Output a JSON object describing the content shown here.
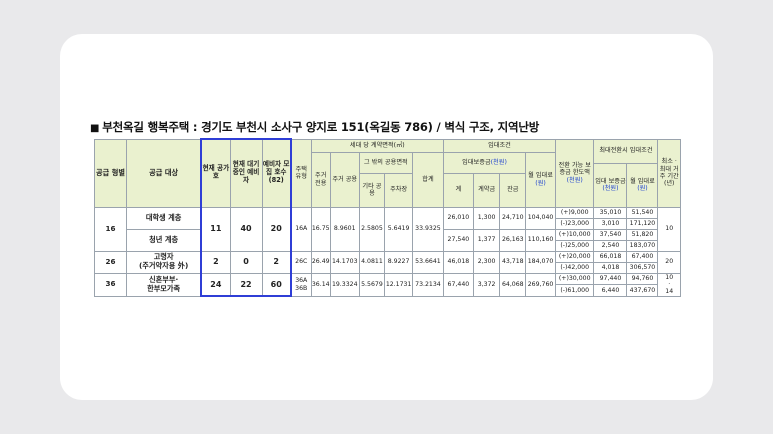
{
  "title": "부천옥길 행복주택 : 경기도 부천시 소사구 양지로 151(옥길동 786) / 벽식 구조, 지역난방",
  "title_marker": "■",
  "headers": {
    "supply_type": "공급 형별",
    "supply_target": "공급 대상",
    "current_vacancy": "현재 공가 호",
    "current_waiting": "현재 대기 중인 예비자",
    "reserve_recruit": "예비자 모집 호수",
    "reserve_recruit_count": "(82)",
    "house_type": "주택 유형",
    "area_group": "세대 당 계약면적(㎡)",
    "exclusive": "주거 전용",
    "shared": "주거 공용",
    "other_shared_group": "그 밖의 공용면적",
    "other_shared": "기타 공용",
    "parking": "주차장",
    "total": "합계",
    "lease_terms": "임대조건",
    "deposit_group": "임대보증금",
    "deposit_unit": "(천원)",
    "deposit_total": "계",
    "contract_fee": "계약금",
    "balance": "잔금",
    "monthly_rent": "월 임대료",
    "monthly_unit": "(원)",
    "conversion": "전환 가능 보증금 한도액",
    "conversion_unit": "(천원)",
    "max_conversion": "최대전환시 임대조건",
    "mc_deposit": "임대 보증금",
    "mc_deposit_unit": "(천원)",
    "mc_rent": "월 임대료",
    "mc_rent_unit": "(원)",
    "min_residence": "최소 · 최대 거주 기간 (년)"
  },
  "rows": {
    "r16": {
      "type": "16",
      "vacancy": "11",
      "waiting": "40",
      "reserve": "20",
      "house_type": "16A",
      "exclusive": "16.75",
      "shared": "8.9601",
      "other_shared": "2.5805",
      "parking": "5.6419",
      "total": "33.9325",
      "min_residence": "10",
      "targets": [
        {
          "name": "대학생 계층",
          "deposit": "26,010",
          "contract": "1,300",
          "balance": "24,710",
          "rent": "104,040",
          "conv_plus": "(+)9,000",
          "conv_minus": "(-)23,000",
          "mc_plus_deposit": "35,010",
          "mc_plus_rent": "51,540",
          "mc_minus_deposit": "3,010",
          "mc_minus_rent": "171,120"
        },
        {
          "name": "청년 계층",
          "deposit": "27,540",
          "contract": "1,377",
          "balance": "26,163",
          "rent": "110,160",
          "conv_plus": "(+)10,000",
          "conv_minus": "(-)25,000",
          "mc_plus_deposit": "37,540",
          "mc_plus_rent": "51,820",
          "mc_minus_deposit": "2,540",
          "mc_minus_rent": "183,070"
        }
      ]
    },
    "r26": {
      "type": "26",
      "target_line1": "고령자",
      "target_line2": "(주거약자용 外)",
      "vacancy": "2",
      "waiting": "0",
      "reserve": "2",
      "house_type": "26C",
      "exclusive": "26.49",
      "shared": "14.1703",
      "other_shared": "4.0811",
      "parking": "8.9227",
      "total": "53.6641",
      "deposit": "46,018",
      "contract": "2,300",
      "balance": "43,718",
      "rent": "184,070",
      "conv_plus": "(+)20,000",
      "conv_minus": "(-)42,000",
      "mc_plus_deposit": "66,018",
      "mc_plus_rent": "67,400",
      "mc_minus_deposit": "4,018",
      "mc_minus_rent": "306,570",
      "min_residence": "20"
    },
    "r36": {
      "type": "36",
      "target_line1": "신혼부부·",
      "target_line2": "한부모가족",
      "vacancy": "24",
      "waiting": "22",
      "reserve": "60",
      "house_type_1": "36A",
      "house_type_2": "36B",
      "exclusive": "36.14",
      "shared": "19.3324",
      "other_shared": "5.5679",
      "parking": "12.1731",
      "total": "73.2134",
      "deposit": "67,440",
      "contract": "3,372",
      "balance": "64,068",
      "rent": "269,760",
      "conv_plus": "(+)30,000",
      "conv_minus": "(-)61,000",
      "mc_plus_deposit": "97,440",
      "mc_plus_rent": "94,760",
      "mc_minus_deposit": "6,440",
      "mc_minus_rent": "437,670",
      "min_residence_1": "10",
      "min_residence_dot": "·",
      "min_residence_2": "14"
    }
  }
}
